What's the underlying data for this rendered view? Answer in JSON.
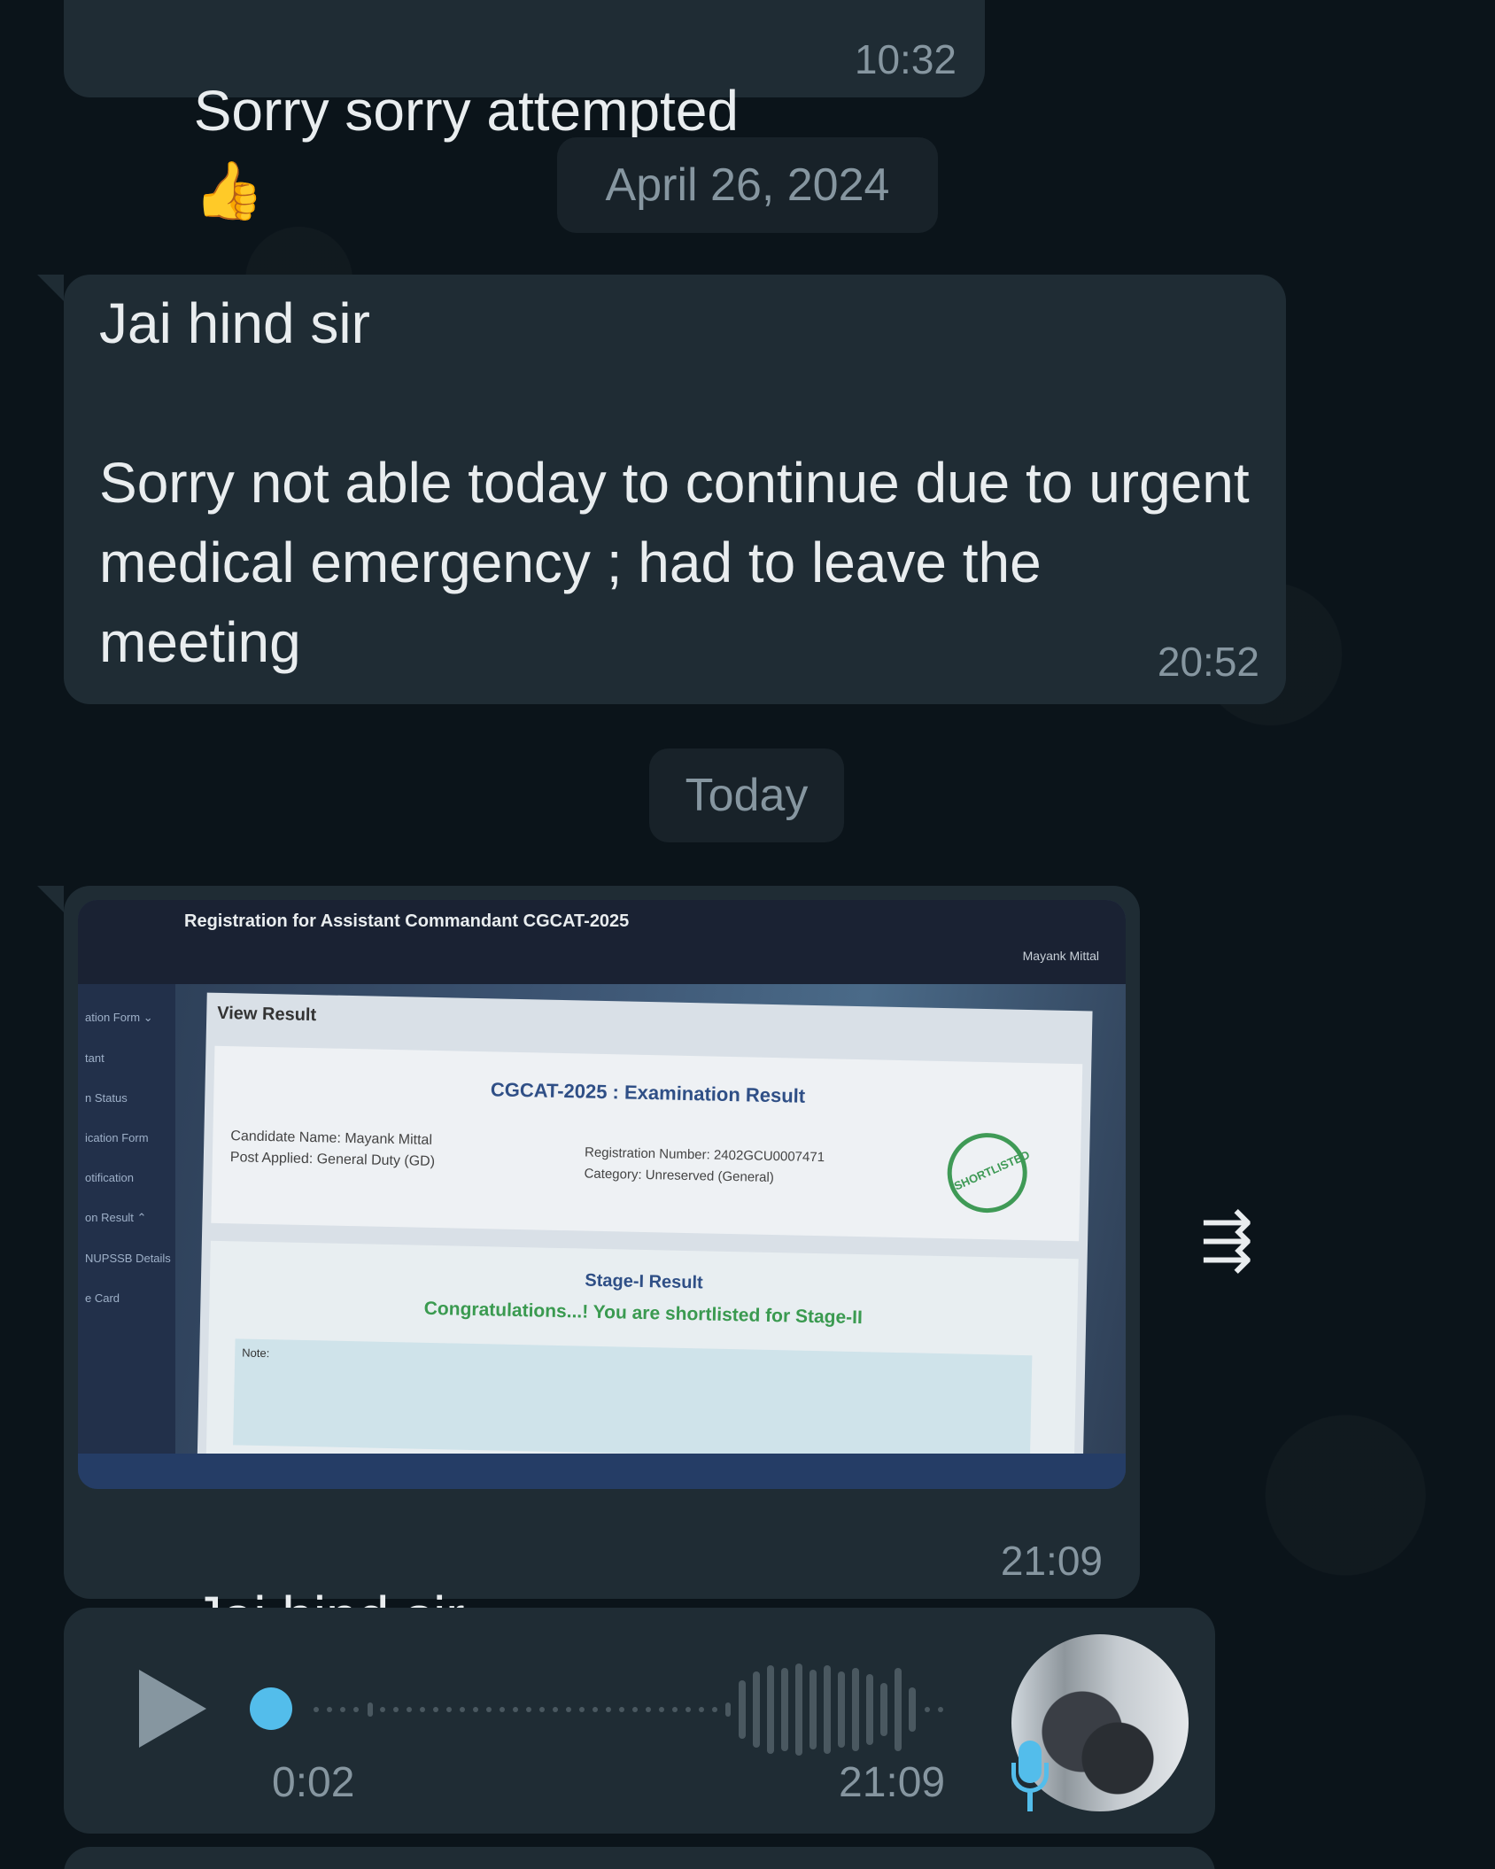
{
  "messages": [
    {
      "text": "Sorry sorry attempted",
      "emoji": "👍",
      "time": "10:32"
    },
    {
      "text": "Jai hind sir\n\nSorry not able today to continue due to urgent medical emergency ; had to leave the meeting",
      "time": "20:52"
    },
    {
      "caption": "Jai hind sir",
      "emoji": "💙🫡🙇‍♀️",
      "time": "21:09",
      "image": {
        "header_title": "Registration for Assistant Commandant CGCAT-2025",
        "user_name": "Mayank Mittal",
        "sidebar_items": [
          "ation Form ⌄",
          "tant",
          "n Status",
          "ication Form",
          "otification",
          "on Result ⌃",
          "NUPSSB Details",
          "e Card"
        ],
        "view_result": "View Result",
        "result_title": "CGCAT-2025 : Examination Result",
        "candidate_line": "Candidate Name: Mayank Mittal",
        "post_line": "Post Applied: General Duty (GD)",
        "reg_line": "Registration Number: 2402GCU0007471",
        "category_line": "Category: Unreserved (General)",
        "stamp_text": "SHORTLISTED",
        "stage_title": "Stage-I Result",
        "stage_msg": "Congratulations...! You are shortlisted for Stage-II",
        "note_label": "Note:"
      }
    },
    {
      "type": "voice",
      "duration": "0:02",
      "time": "21:09"
    }
  ],
  "dates": {
    "first": "April 26, 2024",
    "second": "Today"
  },
  "icons": {
    "forward": "forward-icon",
    "play": "play-icon",
    "mic": "microphone-icon"
  },
  "colors": {
    "background": "#0b141a",
    "bubble": "#1f2c34",
    "accent": "#53bdeb",
    "meta": "#8696a0"
  }
}
